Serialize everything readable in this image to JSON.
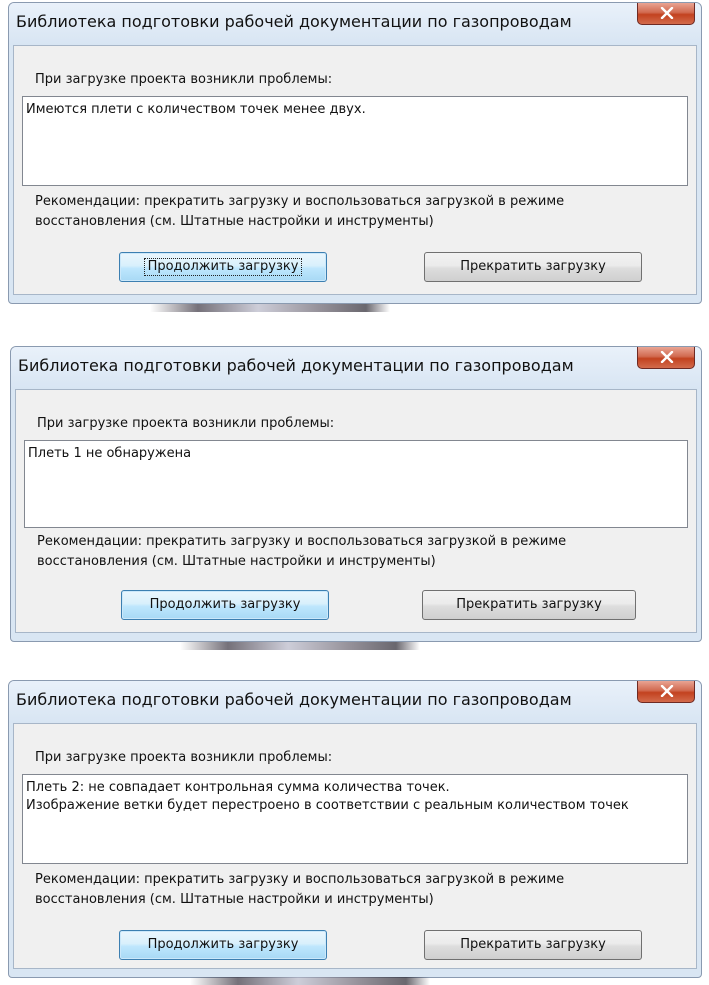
{
  "dialogs": [
    {
      "title": "Библиотека  подготовки рабочей документации по газопроводам",
      "problems_label": "При загрузке проекта  возникли проблемы:",
      "message_lines": [
        "Имеются  плети с количеством точек менее двух."
      ],
      "recommendation_line1": "Рекомендации:   прекратить загрузку и воспользоваться загрузкой в режиме",
      "recommendation_line2": "восстановления  (см. Штатные настройки  и инструменты)",
      "continue_label": "Продолжить  загрузку",
      "abort_label": "Прекратить загрузку"
    },
    {
      "title": "Библиотека  подготовки рабочей документации по газопроводам",
      "problems_label": "При загрузке проекта  возникли проблемы:",
      "message_lines": [
        "Плеть  1  не обнаружена"
      ],
      "recommendation_line1": "Рекомендации:   прекратить загрузку и воспользоваться загрузкой в режиме",
      "recommendation_line2": "восстановления  (см. Штатные настройки  и инструменты)",
      "continue_label": "Продолжить  загрузку",
      "abort_label": "Прекратить загрузку"
    },
    {
      "title": "Библиотека  подготовки рабочей документации по газопроводам",
      "problems_label": "При загрузке проекта  возникли проблемы:",
      "message_lines": [
        "Плеть  2:  не совпадает  контрольная сумма количества точек.",
        "Изображение ветки будет перестроено в соответствии с реальным количеством точек"
      ],
      "recommendation_line1": "Рекомендации:   прекратить загрузку и воспользоваться загрузкой в режиме",
      "recommendation_line2": "восстановления  (см. Штатные настройки  и инструменты)",
      "continue_label": "Продолжить  загрузку",
      "abort_label": "Прекратить загрузку"
    }
  ],
  "icons": {
    "close": "close-icon"
  },
  "colors": {
    "dialog_frame": "#d9e6f3",
    "client_bg": "#f0f0f0",
    "close_button": "#c2421f",
    "default_button": "#bee6fd"
  }
}
